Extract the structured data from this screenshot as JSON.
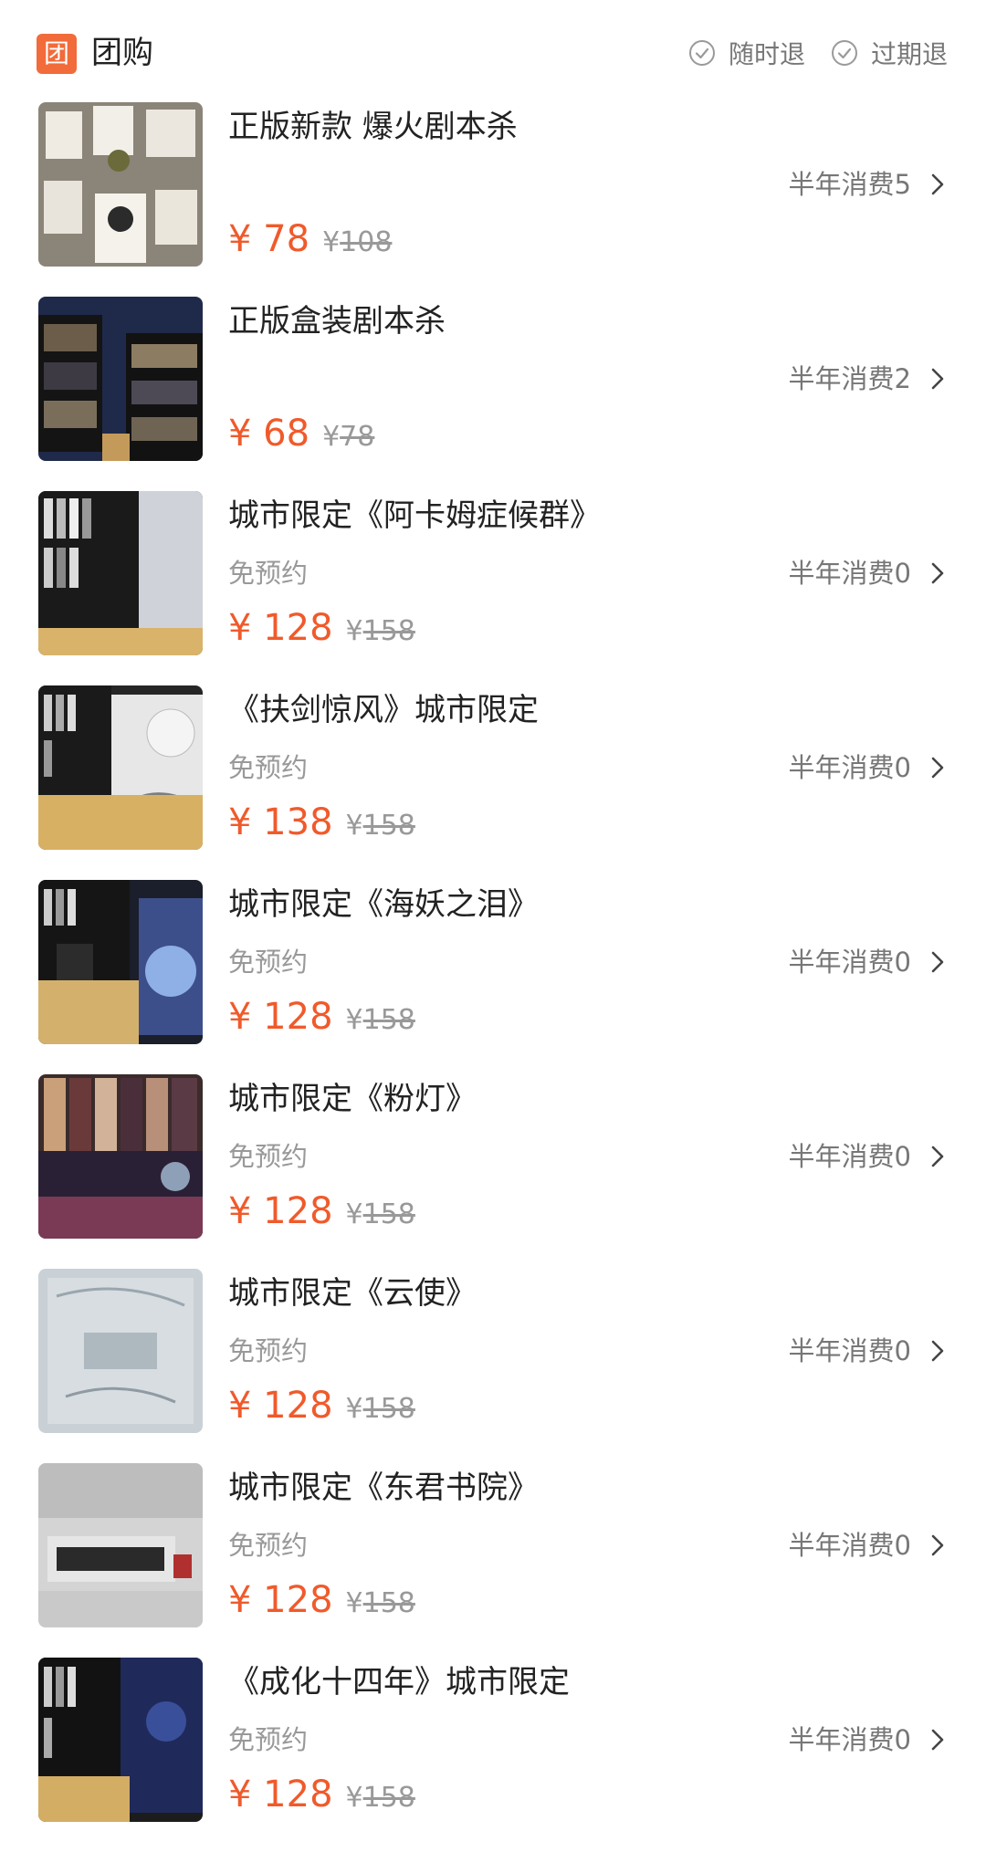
{
  "header": {
    "logo_char": "团",
    "title": "团购",
    "tags": [
      "随时退",
      "过期退"
    ]
  },
  "colors": {
    "accent": "#f26b3a",
    "price": "#f05a2b",
    "muted": "#999999"
  },
  "currency": "¥",
  "items": [
    {
      "title": "正版新款 爆火剧本杀",
      "note": "",
      "price": "78",
      "orig": "108",
      "sales": "半年消费5"
    },
    {
      "title": "正版盒装剧本杀",
      "note": "",
      "price": "68",
      "orig": "78",
      "sales": "半年消费2"
    },
    {
      "title": "城市限定《阿卡姆症候群》",
      "note": "免预约",
      "price": "128",
      "orig": "158",
      "sales": "半年消费0"
    },
    {
      "title": "《扶剑惊风》城市限定",
      "note": "免预约",
      "price": "138",
      "orig": "158",
      "sales": "半年消费0"
    },
    {
      "title": "城市限定《海妖之泪》",
      "note": "免预约",
      "price": "128",
      "orig": "158",
      "sales": "半年消费0"
    },
    {
      "title": "城市限定《粉灯》",
      "note": "免预约",
      "price": "128",
      "orig": "158",
      "sales": "半年消费0"
    },
    {
      "title": "城市限定《云使》",
      "note": "免预约",
      "price": "128",
      "orig": "158",
      "sales": "半年消费0"
    },
    {
      "title": "城市限定《东君书院》",
      "note": "免预约",
      "price": "128",
      "orig": "158",
      "sales": "半年消费0"
    },
    {
      "title": "《成化十四年》城市限定",
      "note": "免预约",
      "price": "128",
      "orig": "158",
      "sales": "半年消费0"
    }
  ]
}
